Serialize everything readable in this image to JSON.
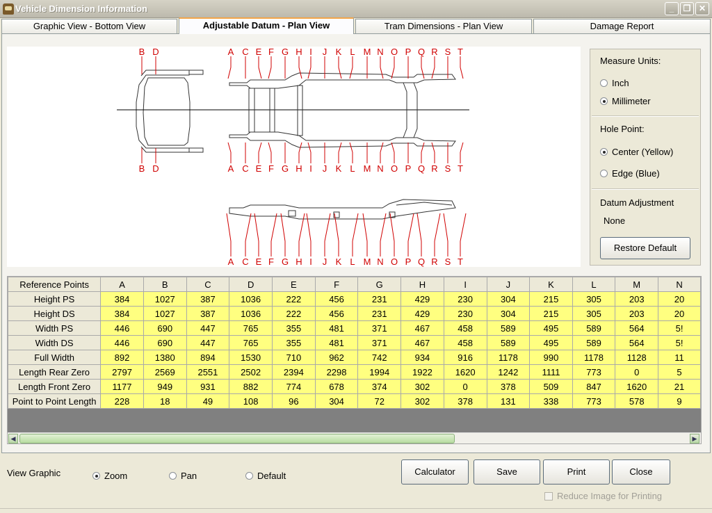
{
  "window": {
    "title": "Vehicle Dimension Information"
  },
  "tabs": [
    {
      "label": "Graphic View - Bottom View"
    },
    {
      "label": "Adjustable Datum - Plan View"
    },
    {
      "label": "Tram Dimensions - Plan View"
    },
    {
      "label": "Damage Report"
    }
  ],
  "drawing": {
    "front_labels": [
      "B",
      "D"
    ],
    "point_labels": [
      "A",
      "C",
      "E",
      "F",
      "G",
      "H",
      "I",
      "J",
      "K",
      "L",
      "M",
      "N",
      "O",
      "P",
      "Q",
      "R",
      "S",
      "T"
    ],
    "label_color": "#d00000"
  },
  "sidebox": {
    "measure_units": {
      "title": "Measure Units:",
      "options": [
        "Inch",
        "Millimeter"
      ],
      "selected": "Millimeter"
    },
    "hole_point": {
      "title": "Hole Point:",
      "options": [
        "Center (Yellow)",
        "Edge (Blue)"
      ],
      "selected": "Center (Yellow)"
    },
    "datum": {
      "title": "Datum Adjustment",
      "value": "None",
      "restore_label": "Restore Default"
    }
  },
  "grid": {
    "corner_label": "Reference Points",
    "columns": [
      "A",
      "B",
      "C",
      "D",
      "E",
      "F",
      "G",
      "H",
      "I",
      "J",
      "K",
      "L",
      "M",
      "N"
    ],
    "rows": [
      {
        "label": "Height PS",
        "values": [
          "384",
          "1027",
          "387",
          "1036",
          "222",
          "456",
          "231",
          "429",
          "230",
          "304",
          "215",
          "305",
          "203",
          "20"
        ]
      },
      {
        "label": "Height DS",
        "values": [
          "384",
          "1027",
          "387",
          "1036",
          "222",
          "456",
          "231",
          "429",
          "230",
          "304",
          "215",
          "305",
          "203",
          "20"
        ]
      },
      {
        "label": "Width PS",
        "values": [
          "446",
          "690",
          "447",
          "765",
          "355",
          "481",
          "371",
          "467",
          "458",
          "589",
          "495",
          "589",
          "564",
          "5!"
        ]
      },
      {
        "label": "Width DS",
        "values": [
          "446",
          "690",
          "447",
          "765",
          "355",
          "481",
          "371",
          "467",
          "458",
          "589",
          "495",
          "589",
          "564",
          "5!"
        ]
      },
      {
        "label": "Full Width",
        "values": [
          "892",
          "1380",
          "894",
          "1530",
          "710",
          "962",
          "742",
          "934",
          "916",
          "1178",
          "990",
          "1178",
          "1128",
          "11"
        ]
      },
      {
        "label": "Length Rear Zero",
        "values": [
          "2797",
          "2569",
          "2551",
          "2502",
          "2394",
          "2298",
          "1994",
          "1922",
          "1620",
          "1242",
          "1111",
          "773",
          "0",
          "5"
        ]
      },
      {
        "label": "Length Front Zero",
        "values": [
          "1177",
          "949",
          "931",
          "882",
          "774",
          "678",
          "374",
          "302",
          "0",
          "378",
          "509",
          "847",
          "1620",
          "21"
        ]
      },
      {
        "label": "Point to Point Length",
        "values": [
          "228",
          "18",
          "49",
          "108",
          "96",
          "304",
          "72",
          "302",
          "378",
          "131",
          "338",
          "773",
          "578",
          "9"
        ]
      }
    ],
    "colors": {
      "header": "#ece9d8",
      "value_cell": "#ffff80",
      "empty": "#808080"
    }
  },
  "bottom": {
    "view_graphic_label": "View Graphic",
    "view_options": [
      "Zoom",
      "Pan",
      "Default"
    ],
    "view_selected": "Zoom",
    "buttons": {
      "calculator": "Calculator",
      "save": "Save",
      "print": "Print",
      "close": "Close"
    },
    "reduce_label": "Reduce Image for Printing"
  }
}
